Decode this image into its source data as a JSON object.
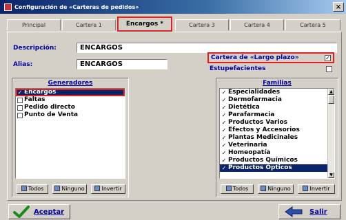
{
  "window": {
    "title": "Configuración de «Carteras de pedidos»",
    "close_glyph": "×"
  },
  "tabs": [
    {
      "label": "Principal"
    },
    {
      "label": "Cartera 1"
    },
    {
      "label": "Encargos *"
    },
    {
      "label": "Cartera 3"
    },
    {
      "label": "Cartera 4"
    },
    {
      "label": "Cartera 5"
    }
  ],
  "form": {
    "descripcion_label": "Descripción:",
    "descripcion_value": "ENCARGOS",
    "alias_label": "Alias:",
    "alias_value": "ENCARGOS",
    "cartera_largo_label": "Cartera de «Largo plazo»",
    "cartera_largo_checked": true,
    "estupefacientes_label": "Estupefacientes",
    "estupefacientes_checked": false,
    "check_glyph": "✓"
  },
  "generadores": {
    "title": "Generadores",
    "items": [
      {
        "label": "Encargos",
        "checked": true,
        "selected": true
      },
      {
        "label": "Faltas",
        "checked": false
      },
      {
        "label": "Pedido directo",
        "checked": false
      },
      {
        "label": "Punto de Venta",
        "checked": false
      }
    ],
    "buttons": {
      "todos": "Todos",
      "ninguno": "Ninguno",
      "invertir": "Invertir"
    }
  },
  "familias": {
    "title": "Familias",
    "items": [
      {
        "label": "Especialidades",
        "checked": true
      },
      {
        "label": "Dermofarmacia",
        "checked": true
      },
      {
        "label": "Dietética",
        "checked": true
      },
      {
        "label": "Parafarmacia",
        "checked": true
      },
      {
        "label": "Productos Varios",
        "checked": true
      },
      {
        "label": "Efectos y Accesorios",
        "checked": true
      },
      {
        "label": "Plantas Medicinales",
        "checked": true
      },
      {
        "label": "Veterinaria",
        "checked": true
      },
      {
        "label": "Homeopatía",
        "checked": true
      },
      {
        "label": "Productos Químicos",
        "checked": true
      },
      {
        "label": "Productos Ópticos",
        "checked": true,
        "selected": true
      }
    ],
    "buttons": {
      "todos": "Todos",
      "ninguno": "Ninguno",
      "invertir": "Invertir"
    }
  },
  "footer": {
    "aceptar": "Aceptar",
    "salir": "Salir"
  },
  "colors": {
    "accent_red": "#e02020",
    "label_blue": "#0000a0",
    "selection": "#0a246a"
  }
}
